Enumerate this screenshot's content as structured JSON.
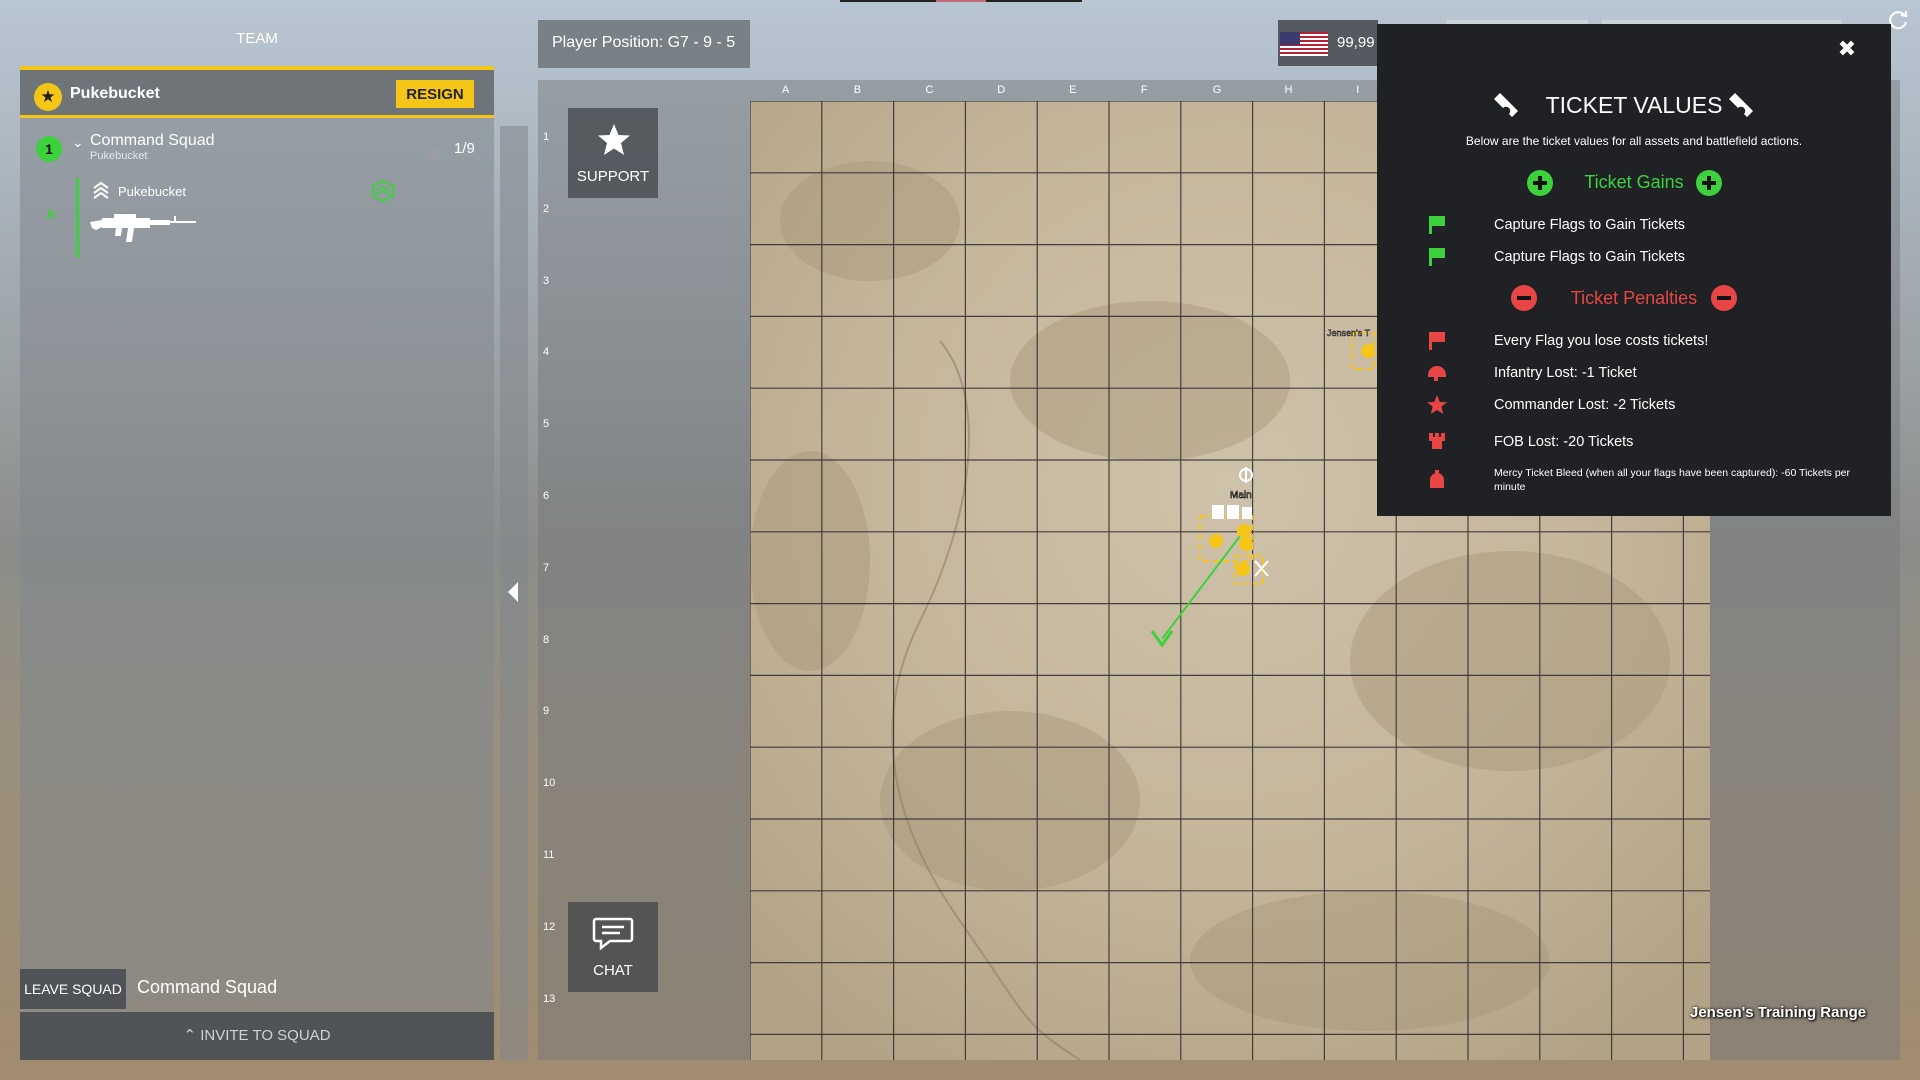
{
  "team": {
    "header": "TEAM",
    "leader": {
      "name": "Pukebucket",
      "resign_label": "RESIGN"
    },
    "squad": {
      "number": "1",
      "name": "Command Squad",
      "leader_sub": "Pukebucket",
      "count": "1/9",
      "members": [
        {
          "slot": "A",
          "name": "Pukebucket"
        }
      ]
    },
    "footer": {
      "leave_label": "LEAVE SQUAD",
      "squad_name": "Command Squad",
      "invite_label": "INVITE TO SQUAD"
    }
  },
  "map": {
    "player_position": "Player Position: G7 - 9 - 5",
    "columns": [
      "A",
      "B",
      "C",
      "D",
      "E",
      "F",
      "G",
      "H",
      "I"
    ],
    "rows": [
      "1",
      "2",
      "3",
      "4",
      "5",
      "6",
      "7",
      "8",
      "9",
      "10",
      "11",
      "12",
      "13"
    ],
    "support_label": "SUPPORT",
    "chat_label": "CHAT",
    "map_name": "Jensen's Training Range",
    "markers": {
      "main_label": "Main",
      "jensen_label": "Jensen's T"
    },
    "terrain_color": "#c9bba2",
    "grid_color": "#2b2b2b"
  },
  "score": {
    "value": "99,99"
  },
  "ticket_values": {
    "title": "TICKET VALUES",
    "description": "Below are the ticket values for all assets and battlefield actions.",
    "gains": {
      "title": "Ticket Gains",
      "color": "#3ed13e",
      "items": [
        {
          "icon": "flag-icon",
          "text": "Capture Flags to Gain Tickets"
        },
        {
          "icon": "flag-icon",
          "text": "Capture Flags to Gain Tickets"
        }
      ]
    },
    "penalties": {
      "title": "Ticket Penalties",
      "color": "#e84545",
      "items": [
        {
          "icon": "flag-icon",
          "text": "Every Flag you lose costs tickets!"
        },
        {
          "icon": "helmet-icon",
          "text": "Infantry Lost: -1 Ticket"
        },
        {
          "icon": "star-icon",
          "text": "Commander Lost: -2 Tickets"
        },
        {
          "icon": "fob-icon",
          "text": "FOB Lost: -20 Tickets"
        },
        {
          "icon": "bleed-icon",
          "text": "Mercy Ticket Bleed (when all your flags have been captured):  -60 Tickets per minute"
        }
      ]
    }
  }
}
